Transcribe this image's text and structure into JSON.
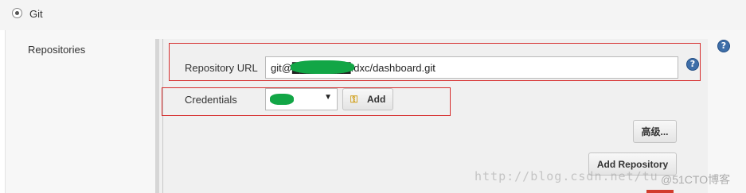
{
  "scm": {
    "option_label": "Git"
  },
  "repositories": {
    "section_label": "Repositories",
    "url_label": "Repository URL",
    "url_value": "git@████████:dxc/dashboard.git",
    "credentials_label": "Credentials",
    "credentials_value": "",
    "add_button_label": "Add",
    "advanced_button_label": "高级...",
    "add_repository_button_label": "Add Repository",
    "help_glyph": "?"
  },
  "watermark": {
    "text": "http://blog.csdn.net/tu",
    "badge": "@51CTO博客"
  },
  "icons": {
    "radio": "radio-selected-icon",
    "help": "help-icon",
    "key": "key-icon",
    "dropdown": "chevron-down-icon"
  },
  "colors": {
    "annotation_box": "#d62d2d",
    "redaction": "#12a646",
    "help_icon": "#3e6ea8"
  }
}
